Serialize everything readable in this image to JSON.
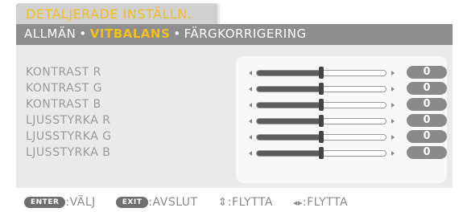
{
  "window": {
    "title": "DETALJERADE INSTÄLLN."
  },
  "tabs": [
    {
      "label": "ALLMÄN"
    },
    {
      "label": "VITBALANS",
      "active": true
    },
    {
      "label": "FÄRGKORRIGERING"
    }
  ],
  "tab_separator": "•",
  "settings": [
    {
      "label": "KONTRAST R",
      "value": "0",
      "level_percent": 50
    },
    {
      "label": "KONTRAST G",
      "value": "0",
      "level_percent": 50
    },
    {
      "label": "KONTRAST B",
      "value": "0",
      "level_percent": 50
    },
    {
      "label": "LJUSSTYRKA R",
      "value": "0",
      "level_percent": 50
    },
    {
      "label": "LJUSSTYRKA G",
      "value": "0",
      "level_percent": 50
    },
    {
      "label": "LJUSSTYRKA B",
      "value": "0",
      "level_percent": 50
    }
  ],
  "footer": {
    "enter_key": "ENTER",
    "enter_action": ":VÄLJ",
    "exit_key": "EXIT",
    "exit_action": ":AVSLUT",
    "updown_icon": "⇕",
    "updown_action": ":FLYTTA",
    "leftright_icon": "◂▸",
    "leftright_action": ":FLYTTA"
  },
  "colors": {
    "accent": "#f0c020",
    "tab_bar": "#8e8e8e",
    "panel": "#eaeaea",
    "value_badge": "#8a8a8a"
  }
}
